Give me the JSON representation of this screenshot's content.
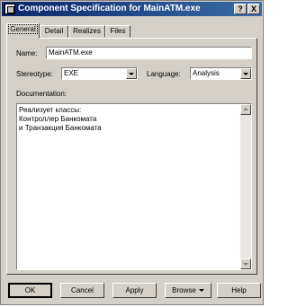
{
  "window": {
    "title": "Component Specification for MainATM.exe",
    "help_glyph": "?",
    "close_glyph": "X"
  },
  "tabs": [
    {
      "label": "General",
      "active": true
    },
    {
      "label": "Detail",
      "active": false
    },
    {
      "label": "Realizes",
      "active": false
    },
    {
      "label": "Files",
      "active": false
    }
  ],
  "general": {
    "name_label": "Name:",
    "name_value": "MainATM.exe",
    "stereotype_label": "Stereotype:",
    "stereotype_value": "EXE",
    "language_label": "Language:",
    "language_value": "Analysis",
    "documentation_label": "Documentation:",
    "documentation_text": "Реализует классы:\nКонтроллер Банкомата\nи Транзакция Банкомата"
  },
  "buttons": {
    "ok": "OK",
    "cancel": "Cancel",
    "apply": "Apply",
    "browse": "Browse",
    "help": "Help"
  },
  "icons": {
    "app": "window-icon",
    "dropdown": "chevron-down-icon",
    "scroll_up": "arrow-up-icon",
    "scroll_down": "arrow-down-icon"
  }
}
